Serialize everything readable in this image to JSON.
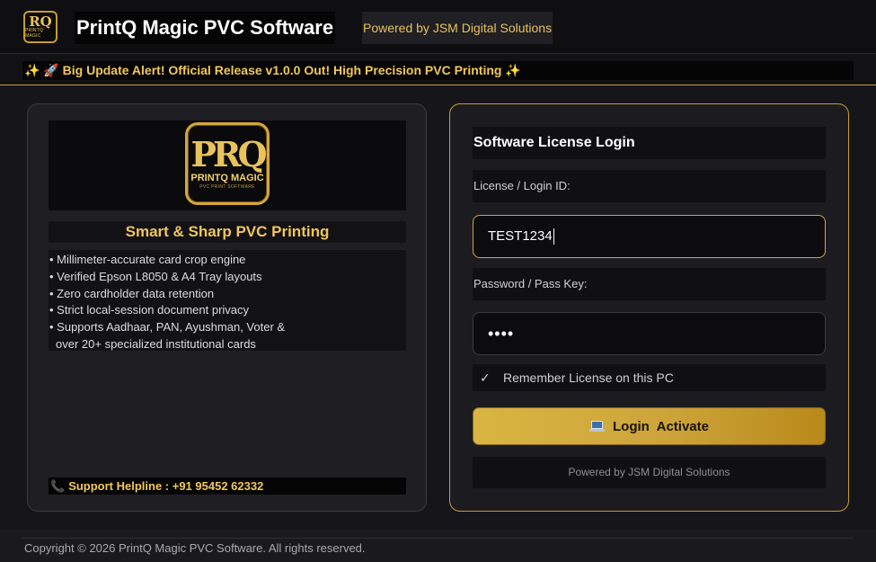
{
  "header": {
    "logo_icon": "printq-magic-logo",
    "title": "PrintQ Magic PVC Software",
    "powered_by": "Powered by JSM Digital Solutions"
  },
  "announcement": {
    "sparkle_left": "✨",
    "rocket": "🚀",
    "text": "Big Update Alert! Official Release v1.0.0 Out! High Precision PVC Printing",
    "sparkle_right": "✨"
  },
  "left_panel": {
    "brand_logo": {
      "mark": "PRQ",
      "name": "PRINTQ MAGIC",
      "sub": "PVC PRINT SOFTWARE"
    },
    "tagline": "Smart & Sharp PVC Printing",
    "features": [
      "• Millimeter-accurate card crop engine",
      "• Verified Epson L8050 & A4 Tray layouts",
      "• Zero cardholder data retention",
      "• Strict local-session document privacy",
      "• Supports Aadhaar, PAN, Ayushman, Voter &",
      "over 20+ specialized institutional cards"
    ],
    "helpline_icon": "phone-icon",
    "helpline": "Support Helpline : +91 95452 62332"
  },
  "login": {
    "title": "Software License Login",
    "license_label": "License / Login ID:",
    "license_value": "TEST1234",
    "password_label": "Password / Pass Key:",
    "password_value": "••••",
    "remember_label": "Remember License on this PC",
    "remember_checked": true,
    "button_label": "Login  Activate",
    "button_icon": "laptop-icon",
    "powered_by": "Powered by JSM Digital Solutions"
  },
  "footer": {
    "copyright": "Copyright © 2026 PrintQ Magic PVC Software. All rights reserved."
  },
  "colors": {
    "accent_gold": "#d4a63a",
    "text_gold": "#f0c75a",
    "background": "#16161a"
  }
}
